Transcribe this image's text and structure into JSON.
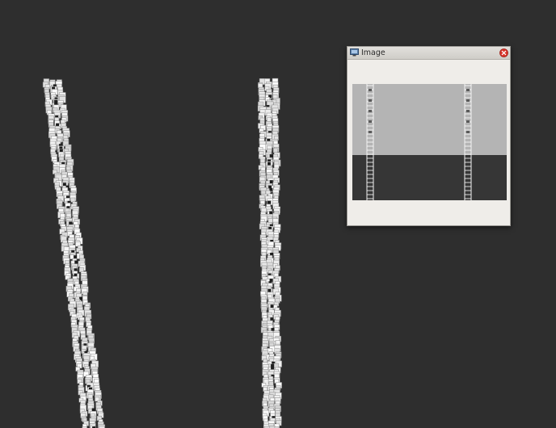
{
  "viewport": {
    "background": "#2e2e2e",
    "objects": [
      {
        "name": "chain-structure-left",
        "color": "#ffffff"
      },
      {
        "name": "chain-structure-right",
        "color": "#ffffff"
      }
    ]
  },
  "image_window": {
    "title": "Image",
    "icon": "monitor-icon",
    "close_icon": "close-icon",
    "close_color": "#d9342b",
    "panel": {
      "upper_color": "#b4b4b4",
      "lower_color": "#363636"
    }
  }
}
